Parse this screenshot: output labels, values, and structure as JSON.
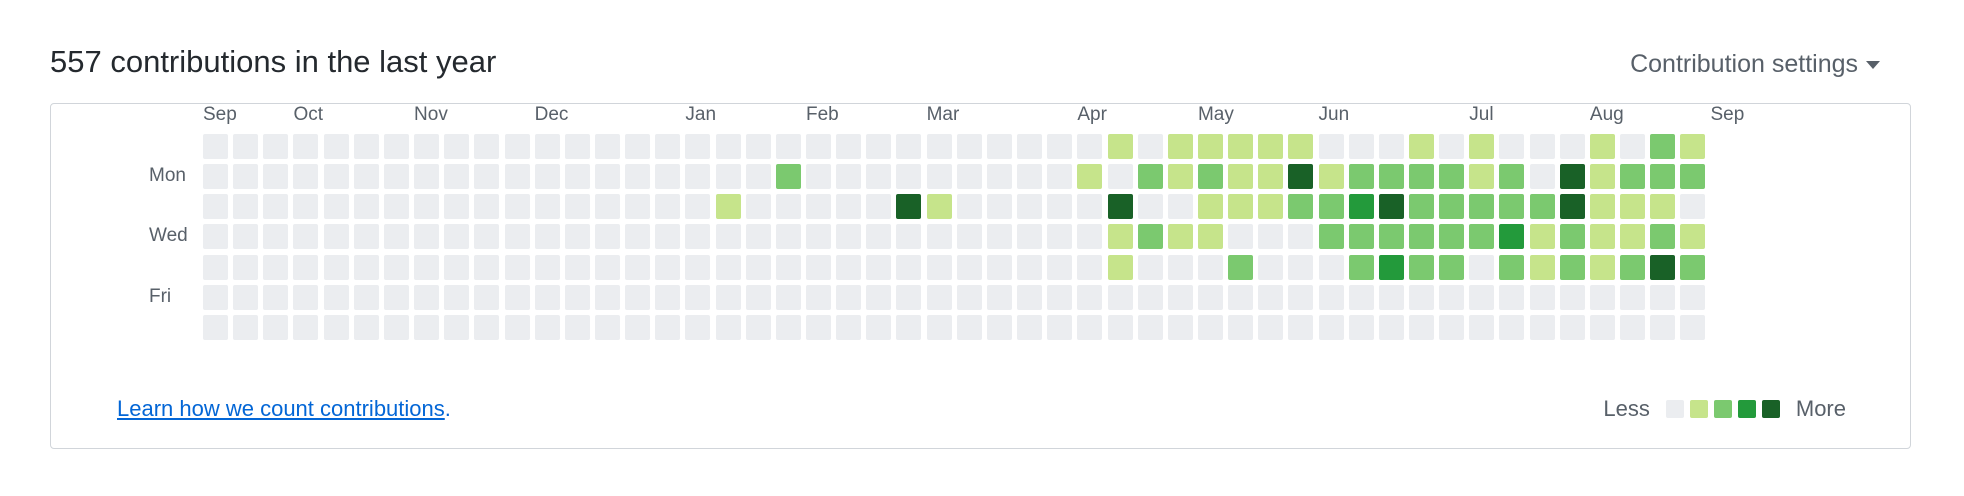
{
  "header": {
    "title": "557 contributions in the last year",
    "settings_label": "Contribution settings"
  },
  "calendar": {
    "months": [
      {
        "label": "Sep",
        "week": 0
      },
      {
        "label": "Oct",
        "week": 3
      },
      {
        "label": "Nov",
        "week": 7
      },
      {
        "label": "Dec",
        "week": 11
      },
      {
        "label": "Jan",
        "week": 16
      },
      {
        "label": "Feb",
        "week": 20
      },
      {
        "label": "Mar",
        "week": 24
      },
      {
        "label": "Apr",
        "week": 29
      },
      {
        "label": "May",
        "week": 33
      },
      {
        "label": "Jun",
        "week": 37
      },
      {
        "label": "Jul",
        "week": 42
      },
      {
        "label": "Aug",
        "week": 46
      },
      {
        "label": "Sep",
        "week": 50
      }
    ],
    "day_labels": [
      {
        "label": "Mon",
        "row": 1
      },
      {
        "label": "Wed",
        "row": 3
      },
      {
        "label": "Fri",
        "row": 5
      }
    ],
    "colors": [
      "#ebedf0",
      "#c6e48b",
      "#7bc96f",
      "#239a3b",
      "#196127"
    ],
    "levels": [
      "00000000000000000000000000000010111110001010001021",
      "00000000000000000002000000000102121141222212041222",
      "00000000000000000100000410000040011122342222241110",
      "00000000000000000000000000000012110002222223121121",
      "00000000000000000000000000000010002000232202121242",
      "00000000000000000000000000000000000000000000000000",
      "00000000000000000000000000000000000000000000000000"
    ]
  },
  "footer": {
    "learn_link": "Learn how we count contributions",
    "learn_suffix": ".",
    "legend_less": "Less",
    "legend_more": "More"
  }
}
